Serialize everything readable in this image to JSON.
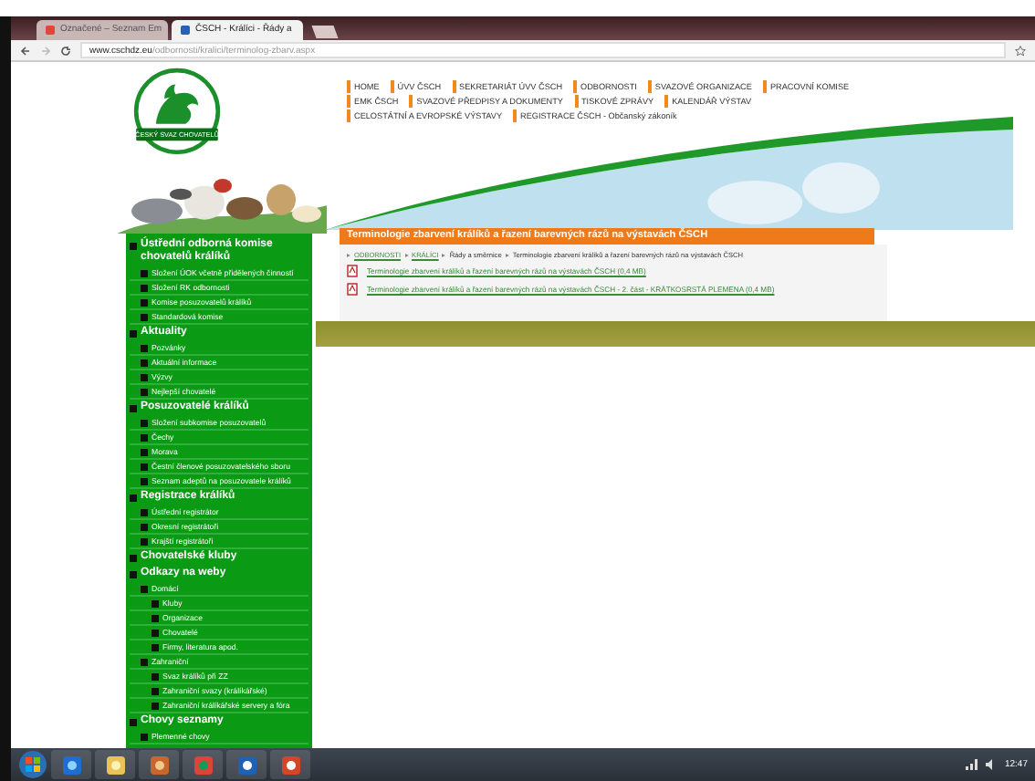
{
  "browser": {
    "tabs": [
      {
        "label": "Označené – Seznam Em",
        "selected": false
      },
      {
        "label": "ČSCH - Králíci - Řády a",
        "selected": true
      }
    ],
    "url_domain": "www.cschdz.eu",
    "url_path": "/odbornosti/kralici/terminolog-zbarv.aspx"
  },
  "logo_text": "ČESKÝ SVAZ CHOVATELŮ",
  "nav": [
    [
      "HOME",
      "ÚVV ČSCH",
      "SEKRETARIÁT ÚVV ČSCH",
      "ODBORNOSTI",
      "SVAZOVÉ ORGANIZACE",
      "PRACOVNÍ KOMISE"
    ],
    [
      "EMK ČSCH",
      "SVAZOVÉ PŘEDPISY A DOKUMENTY",
      "TISKOVÉ ZPRÁVY",
      "KALENDÁŘ VÝSTAV"
    ],
    [
      "CELOSTÁTNÍ A EVROPSKÉ VÝSTAVY",
      "REGISTRACE ČSCH - Občanský zákoník"
    ]
  ],
  "page_title": "Terminologie zbarvení králíků a řazení barevných rázů na výstavách ČSCH",
  "breadcrumb": [
    {
      "label": "ODBORNOSTI",
      "link": true
    },
    {
      "label": "KRÁLÍCI",
      "link": true
    },
    {
      "label": "Řády a směrnice",
      "link": false
    },
    {
      "label": "Terminologie zbarvení králíků a řazení barevných rázů na výstavách ČSCH",
      "link": false
    }
  ],
  "documents": [
    "Terminologie zbarvení králíků a řazení barevných rázů na výstavách ČSCH (0,4 MB)",
    "Terminologie zbarvení králíků a řazení barevných rázů na výstavách ČSCH - 2. část - KRÁTKOSRSTÁ PLEMENA (0,4 MB)"
  ],
  "sidebar": [
    {
      "label": "Ústřední odborná komise chovatelů králíků",
      "children": [
        {
          "label": "Složení ÚOK včetně přidělených činností"
        },
        {
          "label": "Složení RK odbornosti"
        },
        {
          "label": "Komise posuzovatelů králíků"
        },
        {
          "label": "Standardová komise"
        }
      ]
    },
    {
      "label": "Aktuality",
      "children": [
        {
          "label": "Pozvánky"
        },
        {
          "label": "Aktuální informace"
        },
        {
          "label": "Výzvy"
        },
        {
          "label": "Nejlepší chovatelé"
        }
      ]
    },
    {
      "label": "Posuzovatelé králíků",
      "children": [
        {
          "label": "Složení subkomise posuzovatelů"
        },
        {
          "label": "Čechy"
        },
        {
          "label": "Morava"
        },
        {
          "label": "Čestní členové posuzovatelského sboru"
        },
        {
          "label": "Seznam adeptů na posuzovatele králíků"
        }
      ]
    },
    {
      "label": "Registrace králíků",
      "children": [
        {
          "label": "Ústřední registrátor"
        },
        {
          "label": "Okresní registrátoři"
        },
        {
          "label": "Krajští registrátoři"
        }
      ]
    },
    {
      "label": "Chovatelské kluby"
    },
    {
      "label": "Odkazy na weby",
      "children": [
        {
          "label": "Domácí",
          "children": [
            {
              "label": "Kluby"
            },
            {
              "label": "Organizace"
            },
            {
              "label": "Chovatelé"
            },
            {
              "label": "Firmy, literatura apod."
            }
          ]
        },
        {
          "label": "Zahraniční",
          "children": [
            {
              "label": "Svaz králíků při ZZ"
            },
            {
              "label": "Zahraniční svazy (králíkářské)"
            },
            {
              "label": "Zahraniční králíkářské servery a fóra"
            }
          ]
        }
      ]
    },
    {
      "label": "Chovy seznamy",
      "children": [
        {
          "label": "Plemenné chovy"
        }
      ]
    }
  ],
  "clock": "12:47"
}
